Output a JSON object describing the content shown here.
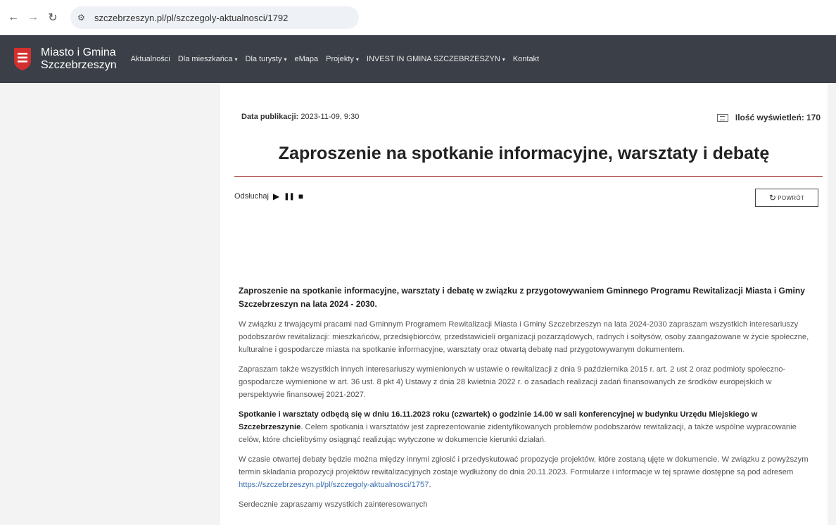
{
  "browser": {
    "url": "szczebrzeszyn.pl/pl/szczegoly-aktualnosci/1792"
  },
  "header": {
    "brand_line1": "Miasto i Gmina",
    "brand_line2": "Szczebrzeszyn",
    "menu": [
      {
        "label": "Aktualności",
        "dropdown": false
      },
      {
        "label": "Dla mieszkańca",
        "dropdown": true
      },
      {
        "label": "Dla turysty",
        "dropdown": true
      },
      {
        "label": "eMapa",
        "dropdown": false
      },
      {
        "label": "Projekty",
        "dropdown": true
      },
      {
        "label": "INVEST IN GMINA SZCZEBRZESZYN",
        "dropdown": true
      },
      {
        "label": "Kontakt",
        "dropdown": false
      }
    ],
    "crest_color": "#d32f2f"
  },
  "meta": {
    "pub_label": "Data publikacji:",
    "pub_value": "2023-11-09, 9:30",
    "views_label": "Ilość wyświetleń:",
    "views_value": "170"
  },
  "article": {
    "title": "Zaproszenie na spotkanie informacyjne, warsztaty i debatę",
    "listen_label": "Odsłuchaj",
    "back_label": "POWRÓT",
    "lead": "Zaproszenie na spotkanie informacyjne, warsztaty i debatę w związku z przygotowywaniem Gminnego Programu Rewitalizacji Miasta i Gminy Szczebrzeszyn na lata 2024 - 2030.",
    "p1": "W związku z trwającymi pracami nad Gminnym Programem Rewitalizacji Miasta i Gminy Szczebrzeszyn na lata 2024-2030 zapraszam wszystkich interesariuszy podobszarów rewitalizacji: mieszkańców, przedsiębiorców, przedstawicieli organizacji pozarządowych, radnych i sołtysów, osoby zaangażowane w życie społeczne, kulturalne i gospodarcze miasta na spotkanie informacyjne, warsztaty oraz otwartą debatę nad przygotowywanym dokumentem.",
    "p2": "Zapraszam także wszystkich innych interesariuszy wymienionych w ustawie o rewitalizacji z dnia 9 października 2015 r. art. 2 ust 2 oraz podmioty społeczno-gospodarcze wymienione w art. 36 ust. 8 pkt 4) Ustawy z dnia 28 kwietnia 2022 r. o zasadach realizacji zadań finansowanych ze środków europejskich w perspektywie finansowej 2021-2027.",
    "p3_bold": "Spotkanie i warsztaty odbędą się w dniu 16.11.2023 roku (czwartek) o godzinie 14.00 w sali konferencyjnej w budynku Urzędu Miejskiego w Szczebrzeszynie",
    "p3_rest": ". Celem spotkania i warsztatów jest zaprezentowanie zidentyfikowanych problemów podobszarów rewitalizacji, a także wspólne wypracowanie celów, które chcielibyśmy osiągnąć realizując wytyczone w dokumencie kierunki działań.",
    "p4": "W czasie otwartej debaty będzie można między innymi zgłosić i przedyskutować propozycje projektów, które zostaną ujęte w dokumencie. W związku z powyższym termin składania propozycji projektów rewitalizacyjnych zostaje wydłużony do dnia 20.11.2023. Formularze i informacje w tej sprawie dostępne są pod adresem ",
    "p4_link": "https://szczebrzeszyn.pl/pl/szczegoly-aktualnosci/1757",
    "p4_end": ".",
    "p5": "Serdecznie zapraszamy wszystkich zainteresowanych"
  }
}
